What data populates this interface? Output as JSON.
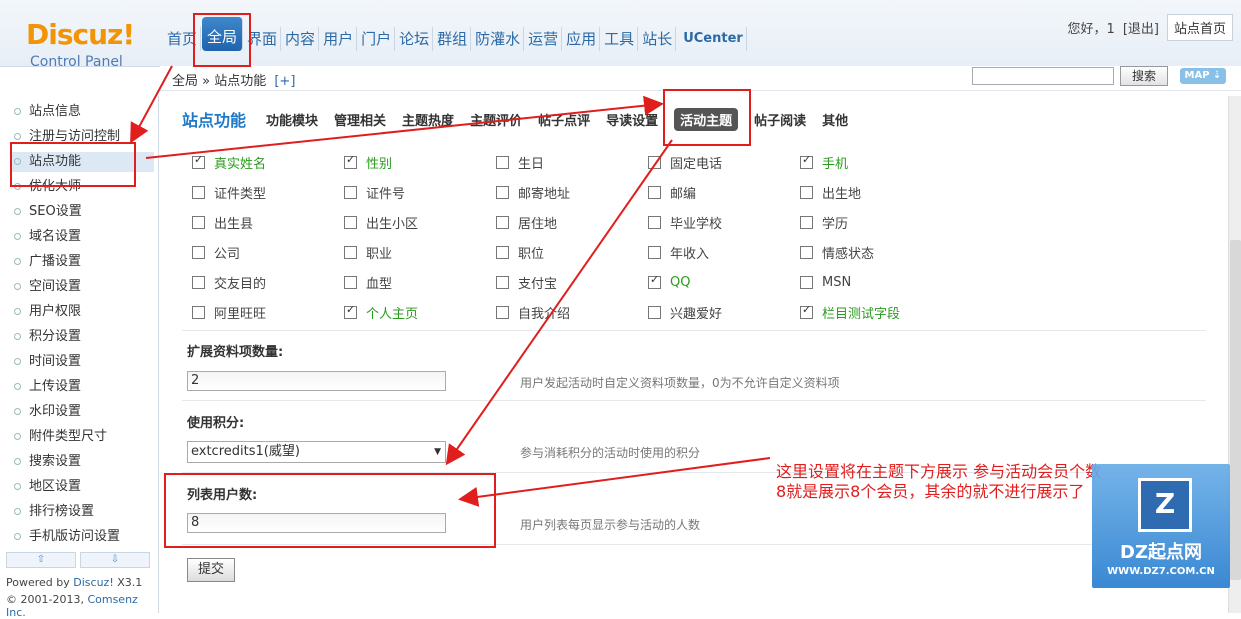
{
  "logo": {
    "title": "Discuz!",
    "subtitle": "Control Panel"
  },
  "topnav": [
    "首页",
    "全局",
    "界面",
    "内容",
    "用户",
    "门户",
    "论坛",
    "群组",
    "防灌水",
    "运营",
    "应用",
    "工具",
    "站长",
    "UCenter"
  ],
  "topnav_active": "全局",
  "user": {
    "greeting": "您好，1",
    "logout": "[退出]",
    "home_button": "站点首页"
  },
  "breadcrumb": {
    "text": "全局 » 站点功能",
    "plus": "[+]"
  },
  "search": {
    "button": "搜索",
    "map_button": "MAP ⇣"
  },
  "sidebar": {
    "items": [
      "站点信息",
      "注册与访问控制",
      "站点功能",
      "优化大师",
      "SEO设置",
      "域名设置",
      "广播设置",
      "空间设置",
      "用户权限",
      "积分设置",
      "时间设置",
      "上传设置",
      "水印设置",
      "附件类型尺寸",
      "搜索设置",
      "地区设置",
      "排行榜设置",
      "手机版访问设置"
    ],
    "active": "站点功能",
    "scroll_up": "⇧",
    "scroll_down": "⇩"
  },
  "footer": {
    "powered_prefix": "Powered by ",
    "powered_link": "Discuz!",
    "powered_version": " X3.1",
    "copyright_prefix": "© 2001-2013, ",
    "copyright_link": "Comsenz Inc."
  },
  "subtabs": {
    "title": "站点功能",
    "items": [
      "功能模块",
      "管理相关",
      "主题热度",
      "主题评价",
      "帖子点评",
      "导读设置",
      "活动主题",
      "帖子阅读",
      "其他"
    ],
    "active": "活动主题"
  },
  "checkbox_rows": [
    [
      [
        "真实姓名",
        true
      ],
      [
        "性别",
        true
      ],
      [
        "生日",
        false
      ],
      [
        "固定电话",
        false
      ],
      [
        "手机",
        true
      ]
    ],
    [
      [
        "证件类型",
        false
      ],
      [
        "证件号",
        false
      ],
      [
        "邮寄地址",
        false
      ],
      [
        "邮编",
        false
      ],
      [
        "出生地",
        false
      ]
    ],
    [
      [
        "出生县",
        false
      ],
      [
        "出生小区",
        false
      ],
      [
        "居住地",
        false
      ],
      [
        "毕业学校",
        false
      ],
      [
        "学历",
        false
      ]
    ],
    [
      [
        "公司",
        false
      ],
      [
        "职业",
        false
      ],
      [
        "职位",
        false
      ],
      [
        "年收入",
        false
      ],
      [
        "情感状态",
        false
      ]
    ],
    [
      [
        "交友目的",
        false
      ],
      [
        "血型",
        false
      ],
      [
        "支付宝",
        false
      ],
      [
        "QQ",
        true
      ],
      [
        "MSN",
        false
      ]
    ],
    [
      [
        "阿里旺旺",
        false
      ],
      [
        "个人主页",
        true
      ],
      [
        "自我介绍",
        false
      ],
      [
        "兴趣爱好",
        false
      ],
      [
        "栏目测试字段",
        true
      ]
    ]
  ],
  "fields": {
    "extend_count": {
      "label": "扩展资料项数量:",
      "value": "2",
      "tip": "用户发起活动时自定义资料项数量，0为不允许自定义资料项"
    },
    "credit": {
      "label": "使用积分:",
      "value": "extcredits1(威望)",
      "tip": "参与消耗积分的活动时使用的积分"
    },
    "list_count": {
      "label": "列表用户数:",
      "value": "8",
      "tip": "用户列表每页显示参与活动的人数"
    }
  },
  "submit_label": "提交",
  "annotation": {
    "line1": "这里设置将在主题下方展示 参与活动会员个数",
    "line2": "8就是展示8个会员，其余的就不进行展示了"
  },
  "watermark": {
    "icon_text": "Z",
    "brand": "DZ起点网",
    "url": "WWW.DZ7.COM.CN"
  },
  "colors": {
    "accent": "#1e79c8",
    "annotation_red": "#e01e1e",
    "checked_green": "#2a9b1e",
    "nav_active": "#2b6aa6"
  }
}
